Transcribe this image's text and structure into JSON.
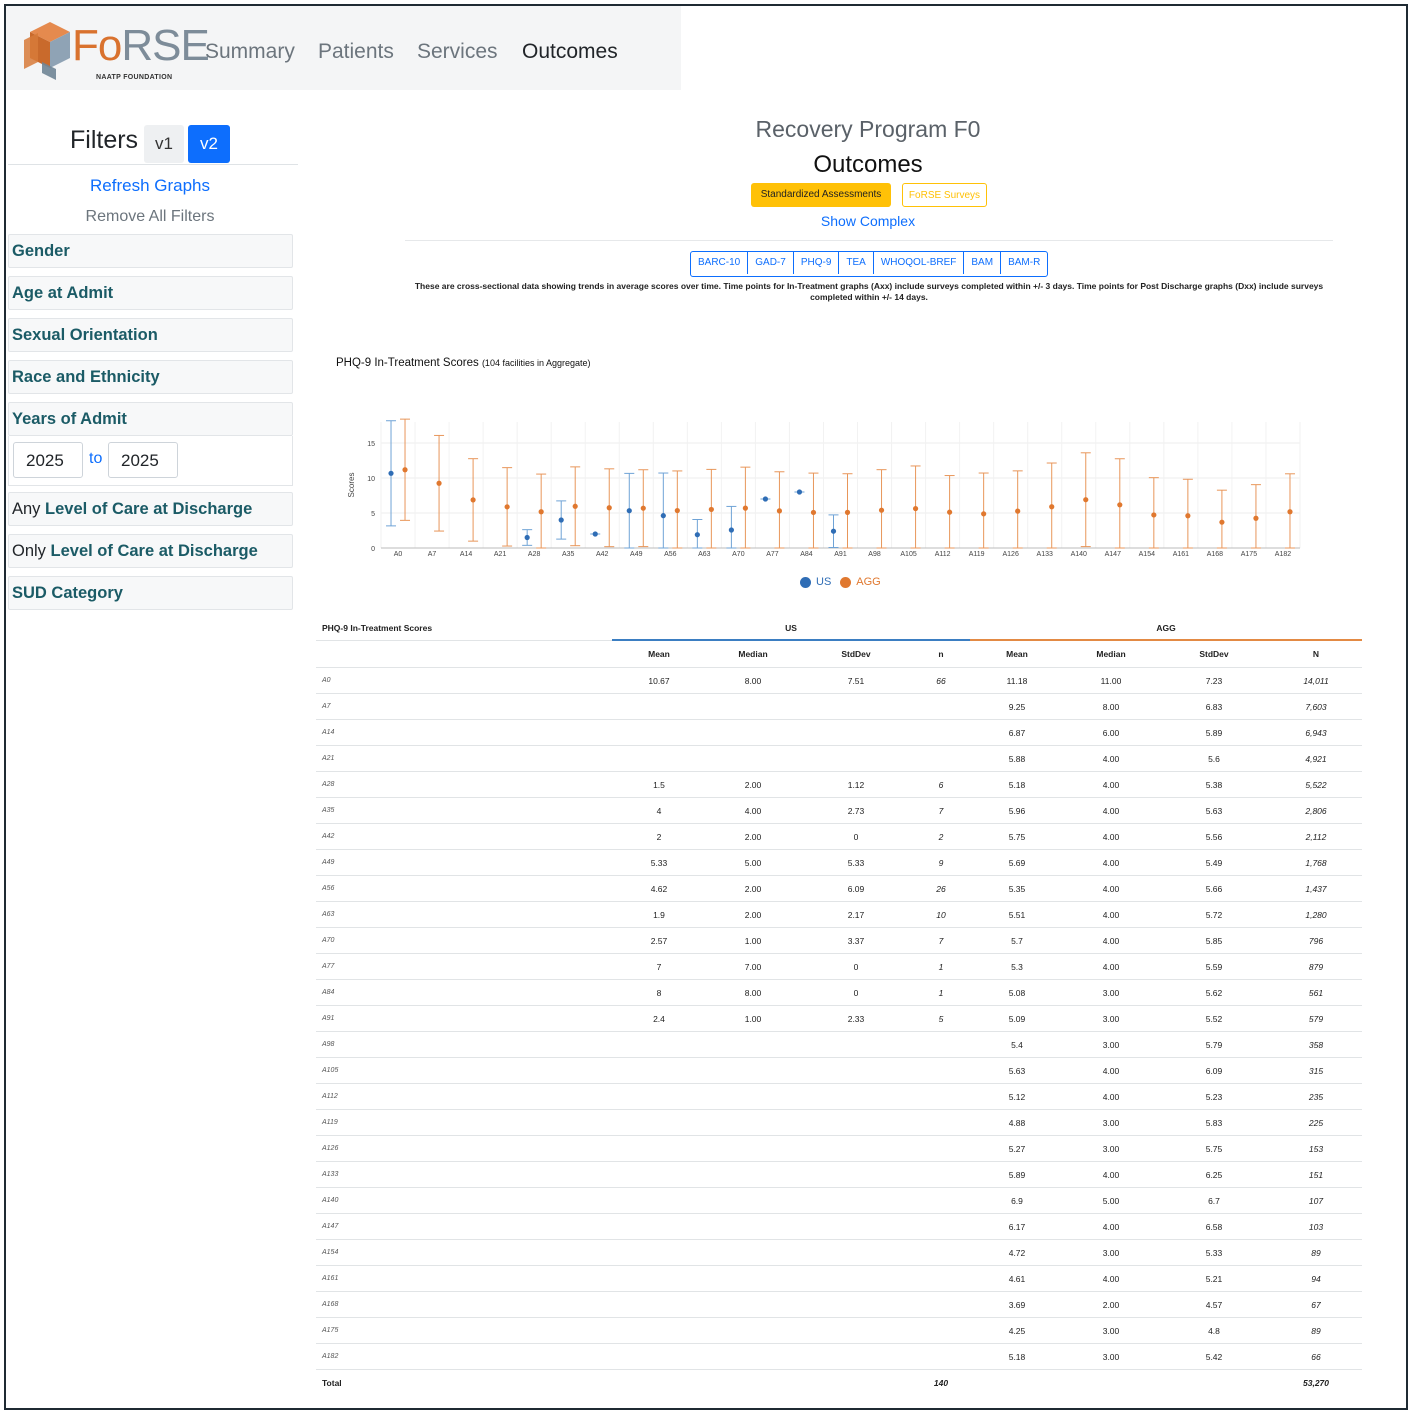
{
  "nav": {
    "brand": "FoRSE",
    "brand_first": "Fo",
    "brand_rest": "RSE",
    "brand_sub": "NAATP FOUNDATION",
    "links": [
      "Summary",
      "Patients",
      "Services",
      "Outcomes"
    ],
    "active": "Outcomes"
  },
  "sidebar": {
    "title": "Filters",
    "v1": "v1",
    "v2": "v2",
    "refresh": "Refresh Graphs",
    "remove": "Remove All Filters",
    "gender": "Gender",
    "age": "Age at Admit",
    "sexual": "Sexual Orientation",
    "race": "Race and Ethnicity",
    "years": "Years of Admit",
    "year_from": "2025",
    "year_to_label": "to",
    "year_to": "2025",
    "any_prefix": "Any",
    "any_loc": "Level of Care at Discharge",
    "only_prefix": "Only",
    "only_loc": "Level of Care at Discharge",
    "sud": "SUD Category"
  },
  "main": {
    "program": "Recovery Program F0",
    "heading": "Outcomes",
    "std_btn": "Standardized Assessments",
    "forse_btn": "FoRSE Surveys",
    "show_complex": "Show Complex",
    "tabs": [
      "BARC-10",
      "GAD-7",
      "PHQ-9",
      "TEA",
      "WHOQOL-BREF",
      "BAM",
      "BAM-R"
    ],
    "note": "These are cross-sectional data showing trends in average scores over time. Time points for In-Treatment graphs (Axx) include surveys completed within +/- 3 days. Time points for Post Discharge graphs (Dxx) include surveys completed within +/- 14 days.",
    "chart_title": "PHQ-9 In-Treatment Scores",
    "chart_subtitle": "(104 facilities in Aggregate)"
  },
  "colors": {
    "us": "#2f6db5",
    "agg": "#e0782f",
    "us_bar": "#6fa3d6",
    "agg_bar": "#e8965a",
    "std_btn_bg": "#ffc107",
    "forse_btn_border": "#ffc107",
    "primary": "#0d6efd"
  },
  "chart_data": {
    "type": "scatter",
    "ylabel": "Scores",
    "ylim": [
      0,
      18
    ],
    "yticks": [
      0,
      5,
      10,
      15
    ],
    "categories": [
      "A0",
      "A7",
      "A14",
      "A21",
      "A28",
      "A35",
      "A42",
      "A49",
      "A56",
      "A63",
      "A70",
      "A77",
      "A84",
      "A91",
      "A98",
      "A105",
      "A112",
      "A119",
      "A126",
      "A133",
      "A140",
      "A147",
      "A154",
      "A161",
      "A168",
      "A175",
      "A182"
    ],
    "legend": [
      "US",
      "AGG"
    ],
    "series": [
      {
        "name": "US",
        "mean": [
          10.67,
          null,
          null,
          null,
          1.5,
          4,
          2,
          5.33,
          4.62,
          1.9,
          2.57,
          7,
          8,
          2.4,
          null,
          null,
          null,
          null,
          null,
          null,
          null,
          null,
          null,
          null,
          null,
          null,
          null
        ],
        "stddev": [
          7.51,
          null,
          null,
          null,
          1.12,
          2.73,
          0,
          5.33,
          6.09,
          2.17,
          3.37,
          0,
          0,
          2.33,
          null,
          null,
          null,
          null,
          null,
          null,
          null,
          null,
          null,
          null,
          null,
          null,
          null
        ]
      },
      {
        "name": "AGG",
        "mean": [
          11.18,
          9.25,
          6.87,
          5.88,
          5.18,
          5.96,
          5.75,
          5.69,
          5.35,
          5.51,
          5.7,
          5.3,
          5.08,
          5.09,
          5.4,
          5.63,
          5.12,
          4.88,
          5.27,
          5.89,
          6.9,
          6.17,
          4.72,
          4.61,
          3.69,
          4.25,
          5.18
        ],
        "stddev": [
          7.23,
          6.83,
          5.89,
          5.6,
          5.38,
          5.63,
          5.56,
          5.49,
          5.66,
          5.72,
          5.85,
          5.59,
          5.62,
          5.52,
          5.79,
          6.09,
          5.23,
          5.83,
          5.75,
          6.25,
          6.7,
          6.58,
          5.33,
          5.21,
          4.57,
          4.8,
          5.42
        ]
      }
    ]
  },
  "table": {
    "title": "PHQ-9 In-Treatment Scores",
    "group_us": "US",
    "group_agg": "AGG",
    "columns": [
      "Mean",
      "Median",
      "StdDev",
      "n",
      "Mean",
      "Median",
      "StdDev",
      "N"
    ],
    "rows": [
      [
        "A0",
        "10.67",
        "8.00",
        "7.51",
        "66",
        "11.18",
        "11.00",
        "7.23",
        "14,011"
      ],
      [
        "A7",
        "",
        "",
        "",
        "",
        "9.25",
        "8.00",
        "6.83",
        "7,603"
      ],
      [
        "A14",
        "",
        "",
        "",
        "",
        "6.87",
        "6.00",
        "5.89",
        "6,943"
      ],
      [
        "A21",
        "",
        "",
        "",
        "",
        "5.88",
        "4.00",
        "5.6",
        "4,921"
      ],
      [
        "A28",
        "1.5",
        "2.00",
        "1.12",
        "6",
        "5.18",
        "4.00",
        "5.38",
        "5,522"
      ],
      [
        "A35",
        "4",
        "4.00",
        "2.73",
        "7",
        "5.96",
        "4.00",
        "5.63",
        "2,806"
      ],
      [
        "A42",
        "2",
        "2.00",
        "0",
        "2",
        "5.75",
        "4.00",
        "5.56",
        "2,112"
      ],
      [
        "A49",
        "5.33",
        "5.00",
        "5.33",
        "9",
        "5.69",
        "4.00",
        "5.49",
        "1,768"
      ],
      [
        "A56",
        "4.62",
        "2.00",
        "6.09",
        "26",
        "5.35",
        "4.00",
        "5.66",
        "1,437"
      ],
      [
        "A63",
        "1.9",
        "2.00",
        "2.17",
        "10",
        "5.51",
        "4.00",
        "5.72",
        "1,280"
      ],
      [
        "A70",
        "2.57",
        "1.00",
        "3.37",
        "7",
        "5.7",
        "4.00",
        "5.85",
        "796"
      ],
      [
        "A77",
        "7",
        "7.00",
        "0",
        "1",
        "5.3",
        "4.00",
        "5.59",
        "879"
      ],
      [
        "A84",
        "8",
        "8.00",
        "0",
        "1",
        "5.08",
        "3.00",
        "5.62",
        "561"
      ],
      [
        "A91",
        "2.4",
        "1.00",
        "2.33",
        "5",
        "5.09",
        "3.00",
        "5.52",
        "579"
      ],
      [
        "A98",
        "",
        "",
        "",
        "",
        "5.4",
        "3.00",
        "5.79",
        "358"
      ],
      [
        "A105",
        "",
        "",
        "",
        "",
        "5.63",
        "4.00",
        "6.09",
        "315"
      ],
      [
        "A112",
        "",
        "",
        "",
        "",
        "5.12",
        "4.00",
        "5.23",
        "235"
      ],
      [
        "A119",
        "",
        "",
        "",
        "",
        "4.88",
        "3.00",
        "5.83",
        "225"
      ],
      [
        "A126",
        "",
        "",
        "",
        "",
        "5.27",
        "3.00",
        "5.75",
        "153"
      ],
      [
        "A133",
        "",
        "",
        "",
        "",
        "5.89",
        "4.00",
        "6.25",
        "151"
      ],
      [
        "A140",
        "",
        "",
        "",
        "",
        "6.9",
        "5.00",
        "6.7",
        "107"
      ],
      [
        "A147",
        "",
        "",
        "",
        "",
        "6.17",
        "4.00",
        "6.58",
        "103"
      ],
      [
        "A154",
        "",
        "",
        "",
        "",
        "4.72",
        "3.00",
        "5.33",
        "89"
      ],
      [
        "A161",
        "",
        "",
        "",
        "",
        "4.61",
        "4.00",
        "5.21",
        "94"
      ],
      [
        "A168",
        "",
        "",
        "",
        "",
        "3.69",
        "2.00",
        "4.57",
        "67"
      ],
      [
        "A175",
        "",
        "",
        "",
        "",
        "4.25",
        "3.00",
        "4.8",
        "89"
      ],
      [
        "A182",
        "",
        "",
        "",
        "",
        "5.18",
        "3.00",
        "5.42",
        "66"
      ]
    ],
    "total": [
      "Total",
      "",
      "",
      "",
      "140",
      "",
      "",
      "",
      "53,270"
    ]
  }
}
